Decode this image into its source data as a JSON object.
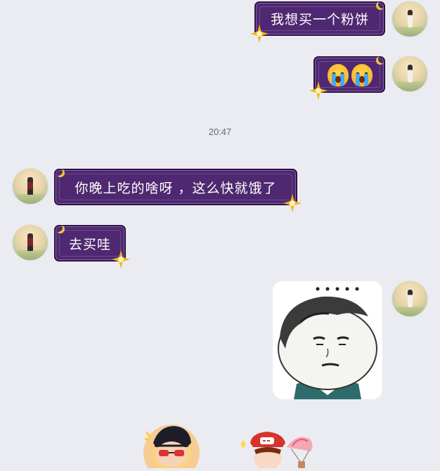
{
  "messages": [
    {
      "side": "me",
      "kind": "text",
      "text": "我想买一个粉饼"
    },
    {
      "side": "me",
      "kind": "emoji",
      "emoji": "crying-face-icon x2"
    },
    {
      "side": "them",
      "kind": "text",
      "text": "你晚上吃的啥呀 ，这么快就饿了"
    },
    {
      "side": "them",
      "kind": "text",
      "text": "去买哇"
    },
    {
      "side": "me",
      "kind": "sticker",
      "sticker": "meme-face-sticker"
    }
  ],
  "timestamp": "20:47",
  "colors": {
    "background": "#ebecf1",
    "bubble_fill": "#4e2870",
    "bubble_border": "#2b1242",
    "star": "#f2b51c",
    "timestamp_text": "#666a73"
  },
  "bottom_bar": {
    "items": [
      "avatar-with-sunglasses-sticker",
      "girl-with-parachute-sticker"
    ]
  }
}
